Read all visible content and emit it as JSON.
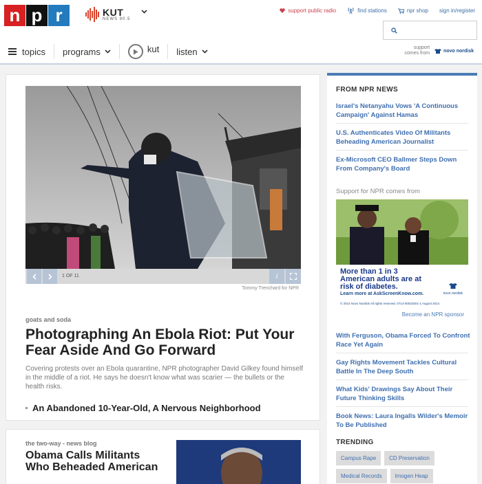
{
  "header": {
    "logo_letters": [
      "n",
      "p",
      "r"
    ],
    "station_name": "KUT",
    "station_sub": "NEWS 90.5",
    "top_links": [
      {
        "label": "support public radio",
        "icon": "heart-icon"
      },
      {
        "label": "find stations",
        "icon": "radio-tower-icon"
      },
      {
        "label": "npr shop",
        "icon": "cart-icon"
      },
      {
        "label": "sign in/register",
        "icon": ""
      }
    ],
    "search_placeholder": ""
  },
  "nav": {
    "topics": "topics",
    "programs": "programs",
    "live": "kut",
    "listen": "listen",
    "sponsor_line1": "support",
    "sponsor_line2": "comes from",
    "sponsor_name": "novo nordisk"
  },
  "article": {
    "slide_counter": "1 OF 11",
    "photo_credit": "Tommy Trenchard for NPR",
    "kicker": "goats and soda",
    "headline": "Photographing An Ebola Riot: Put Your Fear Aside And Go Forward",
    "teaser": "Covering protests over an Ebola quarantine, NPR photographer David Gilkey found himself in the middle of a riot. He says he doesn't know what was scarier — the bullets or the health risks.",
    "related": "An Abandoned 10-Year-Old, A Nervous Neighborhood"
  },
  "second_story": {
    "kicker": "the two-way - news blog",
    "headline": "Obama Calls Militants Who Beheaded American"
  },
  "sidebar": {
    "heading": "FROM NPR NEWS",
    "top_links": [
      "Israel's Netanyahu Vows 'A Continuous Campaign' Against Hamas",
      "U.S. Authenticates Video Of Militants Beheading American Journalist",
      "Ex-Microsoft CEO Ballmer Steps Down From Company's Board"
    ],
    "support_label": "Support for NPR comes from",
    "ad": {
      "line1": "More than 1 in 3",
      "line2": "American adults are at",
      "line3": "risk of diabetes.",
      "link": "Learn more at AskScreenKnow.com.",
      "fine": "© 2014 Novo Nordisk  All rights reserved.  0714-00022501-1  August 2014",
      "brand": "novo nordisk"
    },
    "become_sponsor": "Become an NPR sponsor",
    "bottom_links": [
      "With Ferguson, Obama Forced To Confront Race Yet Again",
      "Gay Rights Movement Tackles Cultural Battle In The Deep South",
      "What Kids' Drawings Say About Their Future Thinking Skills",
      "Book News: Laura Ingalls Wilder's Memoir To Be Published"
    ],
    "trending_heading": "TRENDING",
    "trending_tags": [
      "Campus Rape",
      "CD Preservation",
      "Medical Records",
      "Imogen Heap"
    ]
  },
  "colors": {
    "npr_red": "#d62021",
    "npr_blue": "#237bbd",
    "link_blue": "#3f6fb0",
    "support_red": "#c9434e",
    "sidebar_accent": "#4a7bb5"
  }
}
